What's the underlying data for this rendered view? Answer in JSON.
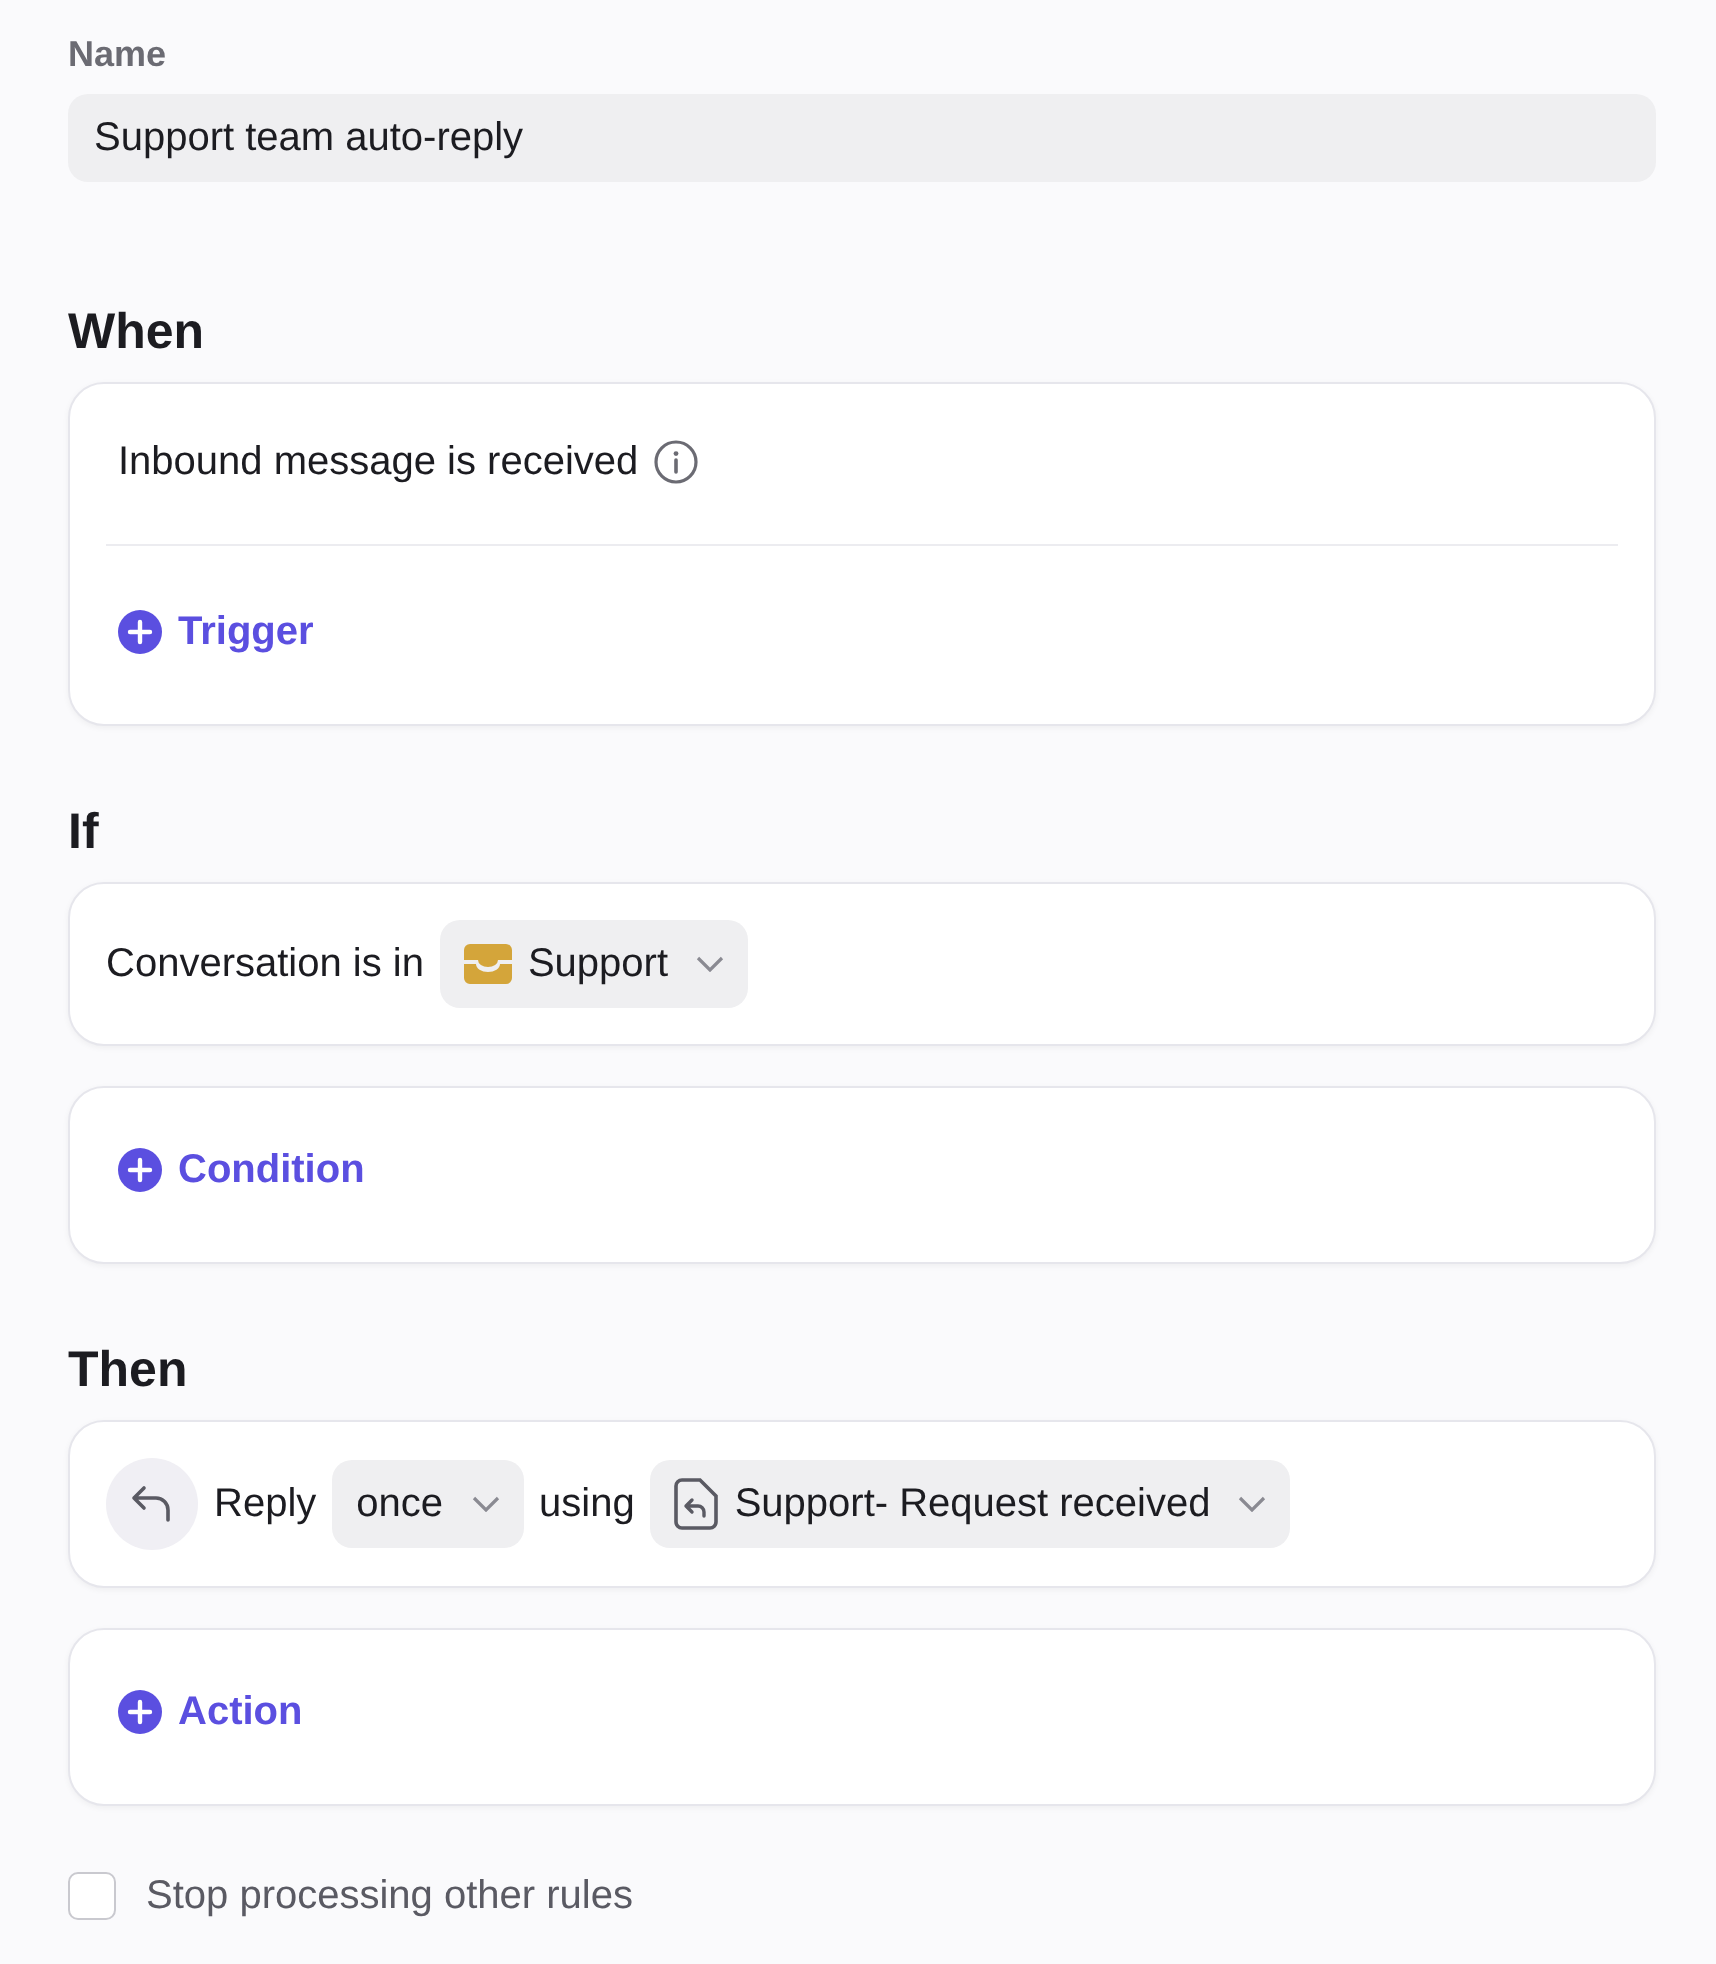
{
  "name_field": {
    "label": "Name",
    "value": "Support team auto-reply"
  },
  "sections": [
    {
      "heading": "When",
      "cards": [
        {
          "kind": "trigger",
          "text": "Inbound message is received",
          "add_label": "Trigger"
        }
      ]
    },
    {
      "heading": "If",
      "cards": [
        {
          "kind": "condition",
          "text": "Conversation is in",
          "dropdown": "Support"
        },
        {
          "kind": "add",
          "add_label": "Condition"
        }
      ]
    },
    {
      "heading": "Then",
      "cards": [
        {
          "kind": "action",
          "verb": "Reply",
          "frequency": "once",
          "connector": "using",
          "template": "Support- Request received"
        },
        {
          "kind": "add",
          "add_label": "Action"
        }
      ]
    }
  ],
  "stop_option": {
    "label": "Stop processing other rules",
    "checked": false
  }
}
